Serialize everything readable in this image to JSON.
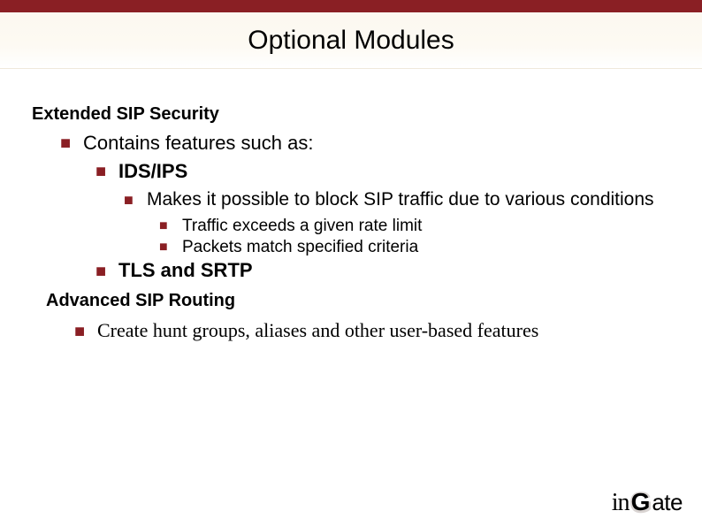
{
  "title": "Optional Modules",
  "sections": {
    "s1": {
      "heading": "Extended SIP Security",
      "b1": "Contains features such as:",
      "b2a": "IDS/IPS",
      "b3a": "Makes it possible to block SIP traffic due to various conditions",
      "b4a": "Traffic exceeds a given rate limit",
      "b4b": "Packets match specified criteria",
      "b2b": "TLS and SRTP"
    },
    "s2": {
      "heading": "Advanced SIP Routing",
      "b1": "Create hunt groups, aliases and other user-based features"
    }
  },
  "logo": {
    "in": "in",
    "g": "G",
    "ate": "ate"
  }
}
